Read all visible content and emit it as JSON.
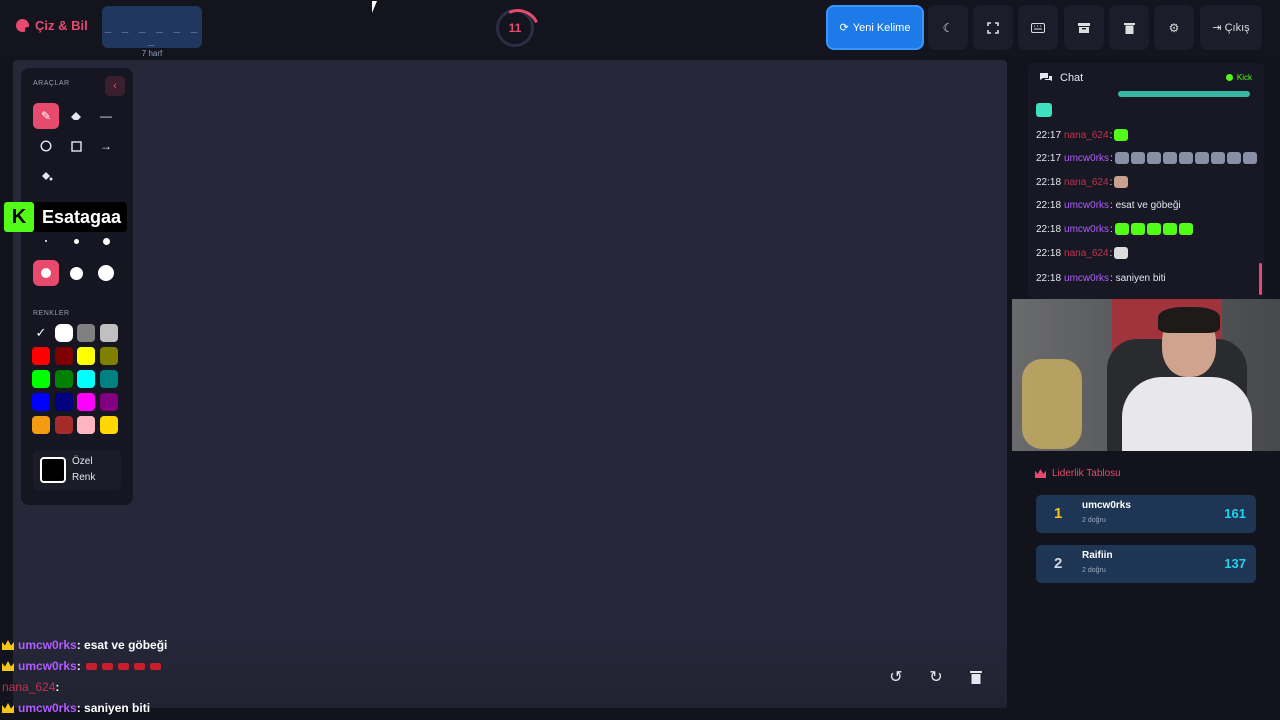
{
  "header": {
    "brand": "Çiz & Bil",
    "word_dashes": "_ _ _ _ _ _ _",
    "word_hint": "7 harf",
    "timer": "11",
    "new_word_label": "Yeni Kelime",
    "exit_label": "Çıkış"
  },
  "tools": {
    "title": "ARAÇLAR",
    "colors_title": "RENKLER",
    "custom_color_label": "Özel Renk",
    "palette": [
      "#000000",
      "#ffffff",
      "#808080",
      "#c0c0c0",
      "#ff0000",
      "#800000",
      "#ffff00",
      "#808000",
      "#00ff00",
      "#008000",
      "#00ffff",
      "#008080",
      "#0000ff",
      "#000080",
      "#ff00ff",
      "#800080",
      "#f39c12",
      "#a52a2a",
      "#ffb6c1",
      "#ffd700"
    ]
  },
  "streamer_badge": {
    "logo": "K",
    "name": "Esatagaa"
  },
  "chat": {
    "title": "Chat",
    "status": "Kick",
    "messages": [
      {
        "time": "22:17",
        "user": "nana_624",
        "text": ":",
        "user_color": "pink"
      },
      {
        "time": "22:17",
        "user": "umcw0rks",
        "text": ":",
        "user_color": "purple"
      },
      {
        "time": "22:18",
        "user": "nana_624",
        "text": ":",
        "user_color": "pink"
      },
      {
        "time": "22:18",
        "user": "umcw0rks",
        "text": ": esat ve göbeği",
        "user_color": "purple"
      },
      {
        "time": "22:18",
        "user": "umcw0rks",
        "text": ":",
        "user_color": "purple"
      },
      {
        "time": "22:18",
        "user": "nana_624",
        "text": ":",
        "user_color": "pink"
      },
      {
        "time": "22:18",
        "user": "umcw0rks",
        "text": ": saniyen biti",
        "user_color": "purple"
      }
    ]
  },
  "leaderboard": {
    "title": "Liderlik Tablosu",
    "rows": [
      {
        "rank": "1",
        "name": "umcw0rks",
        "sub": "2 doğru",
        "score": "161"
      },
      {
        "rank": "2",
        "name": "Raifiin",
        "sub": "2 doğru",
        "score": "137"
      }
    ]
  },
  "overlay_chat": [
    {
      "user": "umcw0rks",
      "text": ": esat ve göbeği"
    },
    {
      "user": "umcw0rks",
      "text": ":"
    },
    {
      "user": "nana_624",
      "text": ":"
    },
    {
      "user": "umcw0rks",
      "text": ": saniyen biti"
    }
  ],
  "colors": {
    "accent": "#e84a6e",
    "primary": "#1c7be8",
    "kick_green": "#53fc18",
    "score": "#22d3ee"
  }
}
